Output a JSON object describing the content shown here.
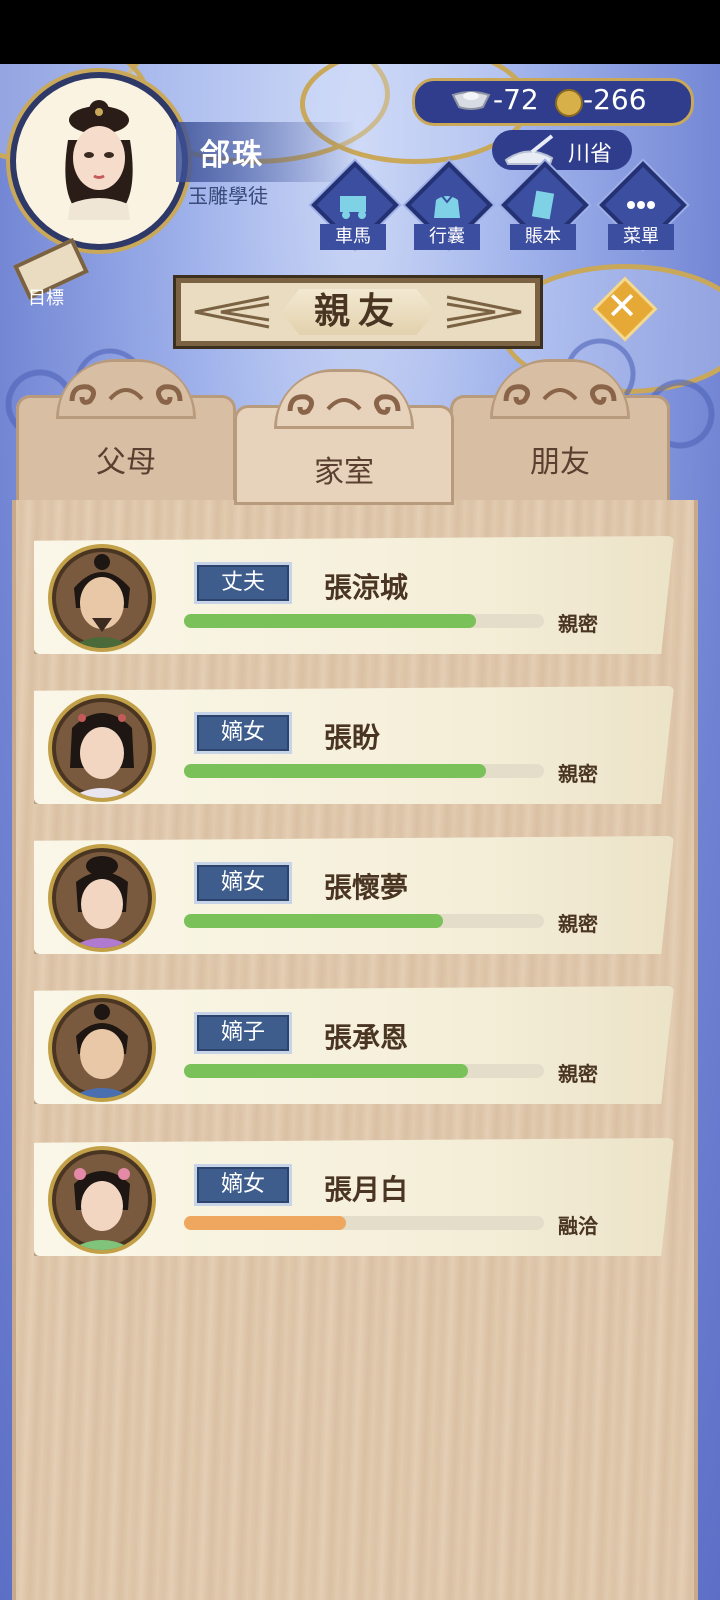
{
  "player": {
    "name": "郃珠",
    "title": "玉雕學徒"
  },
  "currency": {
    "silver": "-72",
    "copper": "-266"
  },
  "location": "川省",
  "menu": [
    {
      "label": "車馬",
      "icon": "carriage-icon"
    },
    {
      "label": "行囊",
      "icon": "bag-icon"
    },
    {
      "label": "賬本",
      "icon": "ledger-icon"
    },
    {
      "label": "菜單",
      "icon": "more-icon"
    }
  ],
  "goal_label": "目標",
  "screen_title": "親友",
  "tabs": [
    {
      "label": "父母",
      "active": false
    },
    {
      "label": "家室",
      "active": true
    },
    {
      "label": "朋友",
      "active": false
    }
  ],
  "relatives": [
    {
      "role": "丈夫",
      "name": "張涼城",
      "relation": "親密",
      "affinity": 0.81,
      "bar_color": "#7bc15a"
    },
    {
      "role": "嫡女",
      "name": "張盼",
      "relation": "親密",
      "affinity": 0.84,
      "bar_color": "#7bc15a"
    },
    {
      "role": "嫡女",
      "name": "張懷夢",
      "relation": "親密",
      "affinity": 0.72,
      "bar_color": "#7bc15a"
    },
    {
      "role": "嫡子",
      "name": "張承恩",
      "relation": "親密",
      "affinity": 0.79,
      "bar_color": "#7bc15a"
    },
    {
      "role": "嫡女",
      "name": "張月白",
      "relation": "融洽",
      "affinity": 0.45,
      "bar_color": "#efa760"
    }
  ]
}
